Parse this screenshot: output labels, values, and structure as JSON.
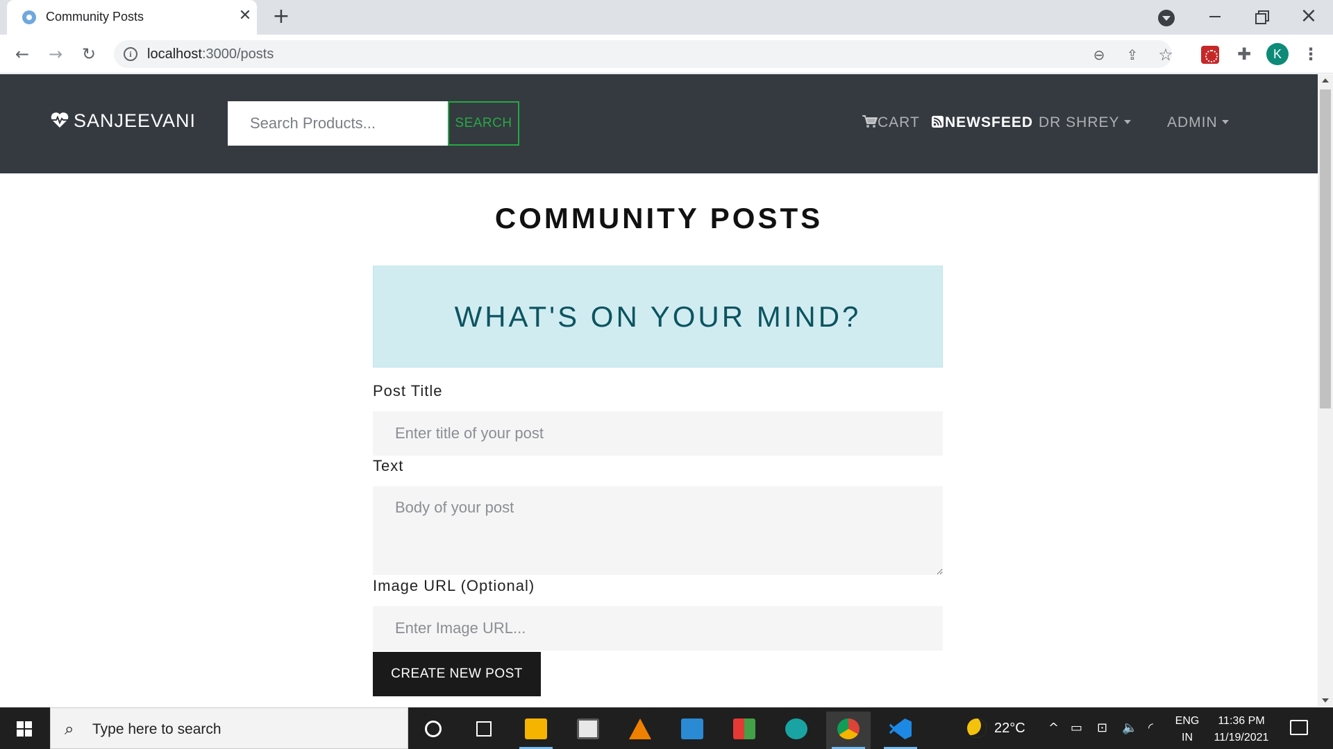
{
  "browser": {
    "tab_title": "Community Posts",
    "tab_close": "✕",
    "new_tab": "+",
    "url_host": "localhost",
    "url_path": ":3000/posts",
    "profile_initial": "K"
  },
  "site": {
    "brand": "SANJEEVANI",
    "search_placeholder": "Search Products...",
    "search_button": "SEARCH",
    "nav": {
      "cart": "CART",
      "newsfeed": "NEWSFEED",
      "user": "DR SHREY",
      "admin": "ADMIN"
    }
  },
  "page": {
    "title": "COMMUNITY POSTS",
    "alert": "WHAT'S ON YOUR MIND?",
    "form": {
      "title_label": "Post Title",
      "title_placeholder": "Enter title of your post",
      "text_label": "Text",
      "text_placeholder": "Body of your post",
      "image_label": "Image URL (Optional)",
      "image_placeholder": "Enter Image URL...",
      "submit": "CREATE NEW POST"
    }
  },
  "taskbar": {
    "search_placeholder": "Type here to search",
    "temperature": "22°C",
    "language": "ENG",
    "region": "IN",
    "time": "11:36 PM",
    "date": "11/19/2021"
  },
  "icons": {
    "brand": "heartbeat-icon",
    "cart": "shopping-cart-icon",
    "newsfeed": "rss-icon"
  },
  "colors": {
    "navbar_bg": "#343a40",
    "search_button": "#28a745",
    "alert_bg": "#d1ecf1",
    "alert_text": "#0c5460",
    "submit_bg": "#1a1a1a"
  }
}
